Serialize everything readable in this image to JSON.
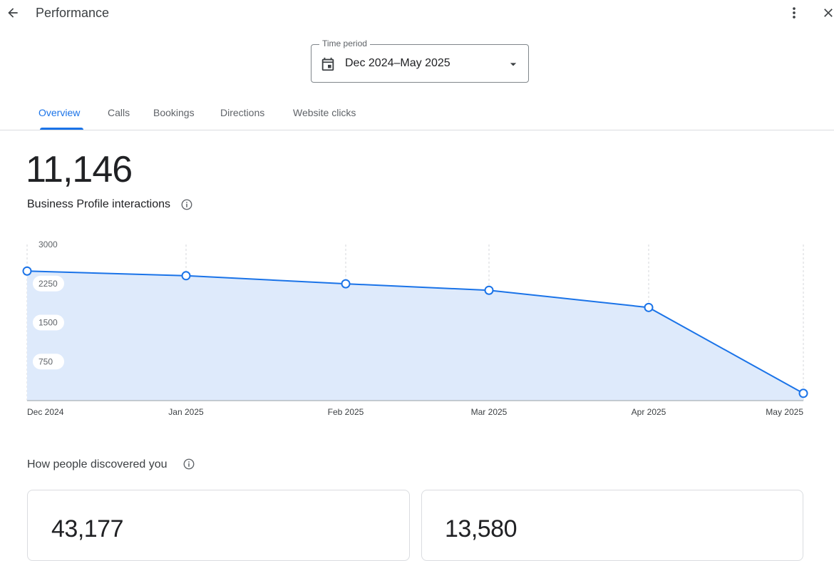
{
  "header": {
    "title": "Performance",
    "back_icon": "arrow-back-icon",
    "more_icon": "more-vert-icon",
    "close_icon": "close-icon"
  },
  "time_period": {
    "label": "Time period",
    "value": "Dec 2024–May 2025",
    "icon": "calendar-icon"
  },
  "tabs": [
    {
      "label": "Overview",
      "active": true
    },
    {
      "label": "Calls",
      "active": false
    },
    {
      "label": "Bookings",
      "active": false
    },
    {
      "label": "Directions",
      "active": false
    },
    {
      "label": "Website clicks",
      "active": false
    }
  ],
  "summary": {
    "total": "11,146",
    "label": "Business Profile interactions"
  },
  "colors": {
    "accent": "#1a73e8",
    "area_fill": "#deeafb"
  },
  "chart_data": {
    "type": "area",
    "x": [
      "Dec 2024",
      "Jan 2025",
      "Feb 2025",
      "Mar 2025",
      "Apr 2025",
      "May 2025"
    ],
    "series": [
      {
        "values": [
          2490,
          2400,
          2245,
          2120,
          1790,
          140
        ]
      }
    ],
    "y_ticks": [
      "3000",
      "2250",
      "1500",
      "750"
    ],
    "ylim": [
      0,
      3000
    ],
    "grid": "vertical-dashed"
  },
  "discovery": {
    "title": "How people discovered you",
    "cards": [
      {
        "value": "43,177"
      },
      {
        "value": "13,580"
      }
    ]
  }
}
